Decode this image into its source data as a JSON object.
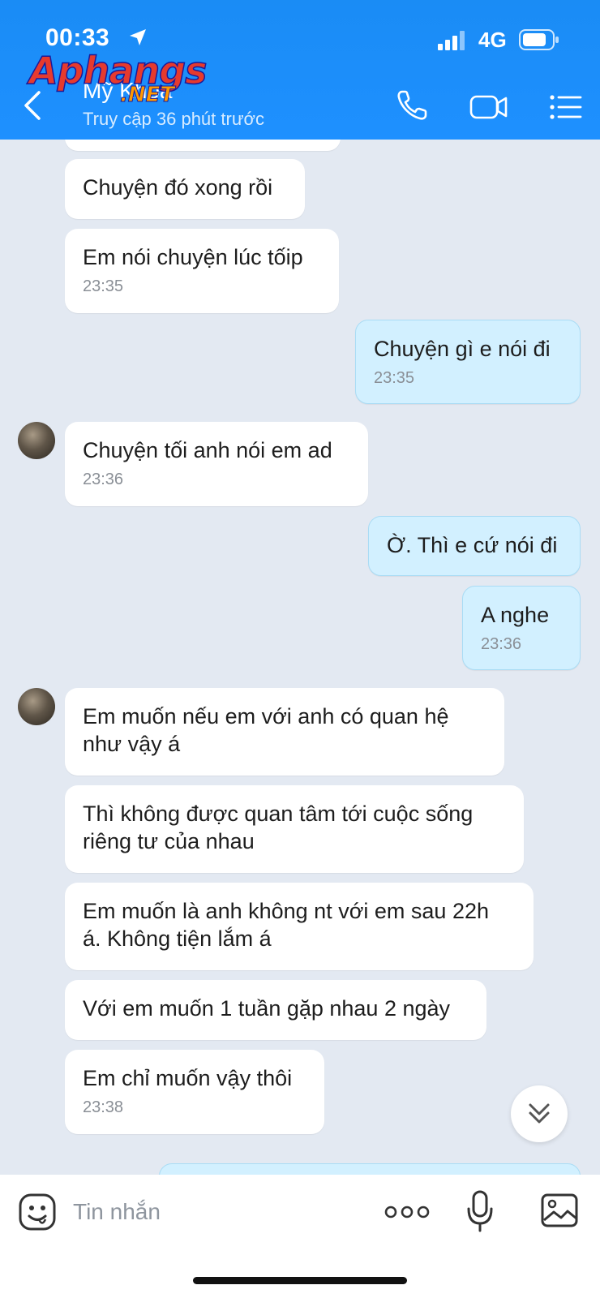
{
  "status_bar": {
    "time": "00:33",
    "network": "4G"
  },
  "watermark": {
    "main": "Aphangs",
    "sub": ".NET"
  },
  "header": {
    "contact_name": "Mỹ Khoa",
    "contact_status": "Truy cập 36 phút trước"
  },
  "messages": [
    {
      "sender": "them",
      "text": "Chuyện đó xong rồi",
      "time": ""
    },
    {
      "sender": "them",
      "text": "Em nói chuyện lúc tốip",
      "time": "23:35"
    },
    {
      "sender": "me",
      "text": "Chuyện gì e nói đi",
      "time": "23:35"
    },
    {
      "sender": "them",
      "text": "Chuyện tối anh nói em ad",
      "time": "23:36"
    },
    {
      "sender": "me",
      "text": "Ờ. Thì e cứ nói đi",
      "time": ""
    },
    {
      "sender": "me",
      "text": "A nghe",
      "time": "23:36"
    },
    {
      "sender": "them",
      "text": "Em  muốn nếu em với anh có quan hệ\nnhư vậy á",
      "time": ""
    },
    {
      "sender": "them",
      "text": "Thì không được quan tâm tới cuộc sống\nriêng tư của nhau",
      "time": ""
    },
    {
      "sender": "them",
      "text": "Em muốn là anh không nt với em sau 22h\ná. Không tiện lắm á",
      "time": ""
    },
    {
      "sender": "them",
      "text": "Với em muốn 1 tuần gặp nhau 2 ngày",
      "time": ""
    },
    {
      "sender": "them",
      "text": "Em chỉ muốn vậy thôi",
      "time": "23:38"
    }
  ],
  "input": {
    "placeholder": "Tin nhắn"
  },
  "colors": {
    "header": "#1e90ff",
    "my_bubble": "#d2f0ff",
    "chat_bg": "#e3e9f2"
  }
}
